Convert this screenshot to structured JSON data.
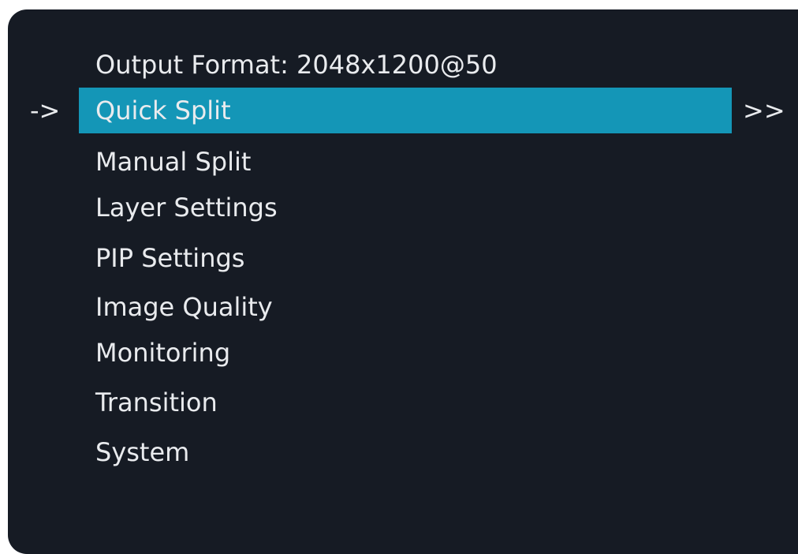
{
  "header": {
    "output_format": "Output Format: 2048x1200@50"
  },
  "pointer": "->",
  "submenu_indicator": ">>",
  "menu": {
    "items": [
      {
        "label": "Quick Split",
        "selected": true
      },
      {
        "label": "Manual Split"
      },
      {
        "label": "Layer Settings"
      },
      {
        "label": "PIP Settings"
      },
      {
        "label": "Image Quality"
      },
      {
        "label": "Monitoring"
      },
      {
        "label": "Transition"
      },
      {
        "label": "System"
      }
    ]
  },
  "colors": {
    "background": "#161b24",
    "selected_highlight": "#1496b7",
    "text": "#e9ebee"
  }
}
